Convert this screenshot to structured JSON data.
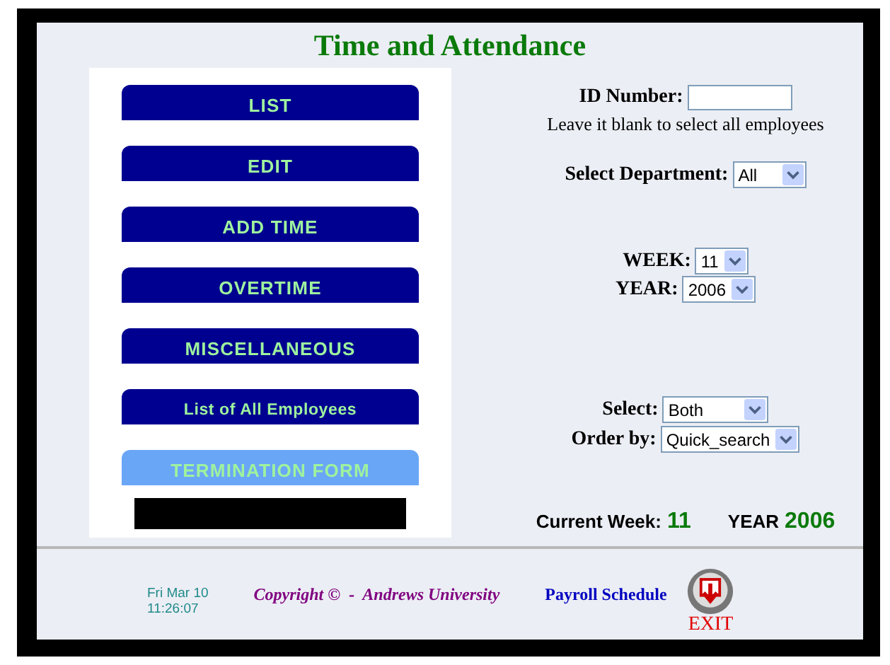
{
  "title": "Time and Attendance",
  "menu": [
    {
      "label": "LIST",
      "highlighted": false
    },
    {
      "label": "EDIT",
      "highlighted": false
    },
    {
      "label": "ADD TIME",
      "highlighted": false
    },
    {
      "label": "OVERTIME",
      "highlighted": false
    },
    {
      "label": "MISCELLANEOUS",
      "highlighted": false
    },
    {
      "label": "List of All Employees",
      "highlighted": false
    },
    {
      "label": "TERMINATION FORM",
      "highlighted": true
    }
  ],
  "form": {
    "id_label": "ID Number:",
    "id_hint": "Leave it blank to select all employees",
    "department_label": "Select Department:",
    "department": "All",
    "week_label": "WEEK:",
    "week": "11",
    "year_label": "YEAR:",
    "year": "2006",
    "select_label": "Select:",
    "select": "Both",
    "order_label": "Order by:",
    "order": "Quick_search"
  },
  "current": {
    "week_label": "Current Week:",
    "week": "11",
    "year_label": "YEAR",
    "year": "2006"
  },
  "footer": {
    "date": "Fri Mar 10",
    "time": "11:26:07",
    "copyright": "Copyright ©  -  Andrews University",
    "payroll": "Payroll Schedule",
    "exit": "EXIT"
  }
}
